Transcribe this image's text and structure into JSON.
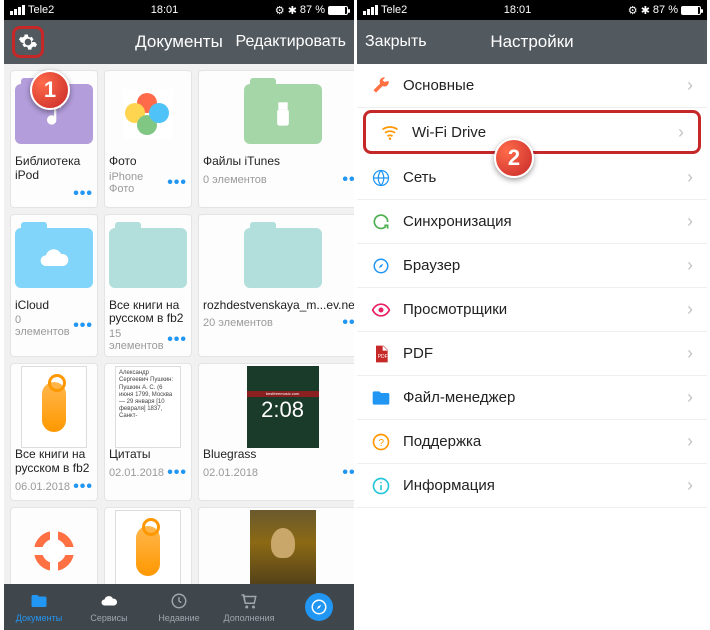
{
  "status": {
    "carrier": "Tele2",
    "time": "18:01",
    "battery": "87 %"
  },
  "left": {
    "title": "Документы",
    "edit": "Редактировать",
    "tiles": [
      {
        "name": "Библиотека iPod",
        "sub": "",
        "type": "folder",
        "color": "#b39ddb",
        "icon": "music"
      },
      {
        "name": "Фото",
        "sub": "iPhone Фото",
        "type": "photos"
      },
      {
        "name": "Файлы iTunes",
        "sub": "0 элементов",
        "type": "folder",
        "color": "#a5d6a7",
        "icon": "usb"
      },
      {
        "name": "iCloud",
        "sub": "0 элементов",
        "type": "folder",
        "color": "#81d4fa",
        "icon": "cloud"
      },
      {
        "name": "Все книги на русском в fb2",
        "sub": "15 элементов",
        "type": "folder",
        "color": "#b2dfdb",
        "icon": ""
      },
      {
        "name": "rozhdestvenskaya_m...ev.net)",
        "sub": "20 элементов",
        "type": "folder",
        "color": "#b2dfdb",
        "icon": ""
      },
      {
        "name": "Все книги на русском в fb2",
        "sub": "06.01.2018",
        "type": "zip"
      },
      {
        "name": "Цитаты",
        "sub": "02.01.2018",
        "type": "text",
        "text": "Александр Сергеевич Пушкин: Пушкин А. С. (6 июня 1799, Москва — 29 января [10 февраля] 1837, Санкт-"
      },
      {
        "name": "Bluegrass",
        "sub": "02.01.2018",
        "type": "bgimg",
        "time": "2:08"
      },
      {
        "name": "",
        "sub": "",
        "type": "life"
      },
      {
        "name": "",
        "sub": "",
        "type": "zip"
      },
      {
        "name": "",
        "sub": "",
        "type": "mona"
      }
    ],
    "tabs": [
      {
        "label": "Документы",
        "icon": "folder",
        "active": true
      },
      {
        "label": "Сервисы",
        "icon": "cloud",
        "active": false
      },
      {
        "label": "Недавние",
        "icon": "clock",
        "active": false
      },
      {
        "label": "Дополнения",
        "icon": "cart",
        "active": false
      },
      {
        "label": "",
        "icon": "compass",
        "active": false
      }
    ]
  },
  "right": {
    "close": "Закрыть",
    "title": "Настройки",
    "rows": [
      {
        "label": "Основные",
        "icon": "wrench",
        "color": "#ff7043",
        "hl": false
      },
      {
        "label": "Wi-Fi Drive",
        "icon": "wifi",
        "color": "#ff9800",
        "hl": true
      },
      {
        "label": "Сеть",
        "icon": "globe",
        "color": "#2196f3",
        "hl": false
      },
      {
        "label": "Синхронизация",
        "icon": "sync",
        "color": "#4caf50",
        "hl": false
      },
      {
        "label": "Браузер",
        "icon": "compass",
        "color": "#2196f3",
        "hl": false
      },
      {
        "label": "Просмотрщики",
        "icon": "eye",
        "color": "#e91e63",
        "hl": false
      },
      {
        "label": "PDF",
        "icon": "pdf",
        "color": "#c62828",
        "hl": false
      },
      {
        "label": "Файл-менеджер",
        "icon": "folder",
        "color": "#2196f3",
        "hl": false
      },
      {
        "label": "Поддержка",
        "icon": "help",
        "color": "#ff9800",
        "hl": false
      },
      {
        "label": "Информация",
        "icon": "info",
        "color": "#26c6da",
        "hl": false
      }
    ]
  },
  "callouts": {
    "one": "1",
    "two": "2"
  }
}
